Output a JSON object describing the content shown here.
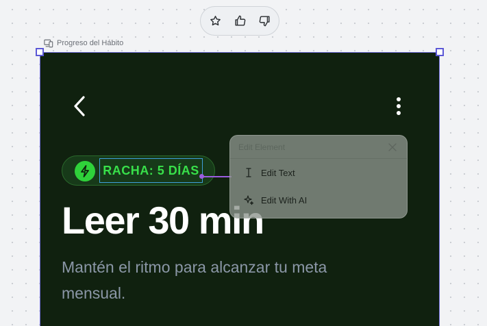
{
  "feedback": {
    "icons": [
      "star-icon",
      "thumbs-up-icon",
      "thumbs-down-icon"
    ]
  },
  "frame": {
    "label": "Progreso del Hábito",
    "label_icon": "device-icon"
  },
  "screen": {
    "background": "#10210f",
    "nav": {
      "back_icon": "chevron-left-icon",
      "more_icon": "more-vertical-icon"
    },
    "badge": {
      "text": "RACHA: 5 DÍAS",
      "icon": "lightning-icon",
      "color": "#2fd13a"
    },
    "title": "Leer 30 min",
    "subtitle": "Mantén el ritmo para alcanzar tu meta mensual."
  },
  "edit_popup": {
    "title": "Edit Element",
    "items": [
      {
        "label": "Edit Text",
        "icon": "text-cursor-icon"
      },
      {
        "label": "Edit With AI",
        "icon": "sparkles-icon"
      }
    ]
  },
  "colors": {
    "selection": "#6e6cd8",
    "connector": "#9b5de0",
    "accent": "#38e04a"
  }
}
